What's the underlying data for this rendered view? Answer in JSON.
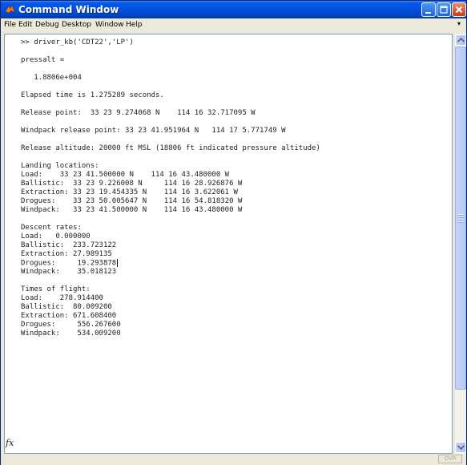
{
  "window": {
    "title": "Command Window",
    "menu": [
      "File",
      "Edit",
      "Debug",
      "Desktop",
      "Window",
      "Help"
    ]
  },
  "console": {
    "lines": [
      ">> driver_kb('CDT22','LP')",
      "",
      "pressalt =",
      "",
      "   1.8806e+004",
      "",
      "Elapsed time is 1.275289 seconds.",
      "",
      "Release point:  33 23 9.274068 N    114 16 32.717095 W",
      "",
      "Windpack release point: 33 23 41.951964 N   114 17 5.771749 W",
      "",
      "Release altitude: 20000 ft MSL (18806 ft indicated pressure altitude)",
      "",
      "Landing locations:",
      "Load:    33 23 41.500000 N    114 16 43.480000 W",
      "Ballistic:  33 23 9.226008 N     114 16 28.926876 W",
      "Extraction: 33 23 19.454335 N    114 16 3.622061 W",
      "Drogues:    33 23 50.005647 N    114 16 54.818320 W",
      "Windpack:   33 23 41.500000 N    114 16 43.480000 W",
      "",
      "Descent rates:",
      "Load:   0.000000",
      "Ballistic:  233.723122",
      "Extraction: 27.989135",
      "Drogues:     19.293878",
      "Windpack:    35.018123",
      "",
      "Times of flight:",
      "Load:    278.914400",
      "Ballistic:  80.009200",
      "Extraction: 671.608400",
      "Drogues:     556.267600",
      "Windpack:    534.009200"
    ],
    "prompt_icon": "fx"
  },
  "status": {
    "ovr": "OVR"
  },
  "icons": {
    "app": "matlab-icon",
    "minimize": "minimize-icon",
    "maximize": "maximize-icon",
    "close": "close-icon"
  },
  "colors": {
    "titlebar": "#0052e0",
    "close": "#d2512a",
    "text": "#222222"
  }
}
